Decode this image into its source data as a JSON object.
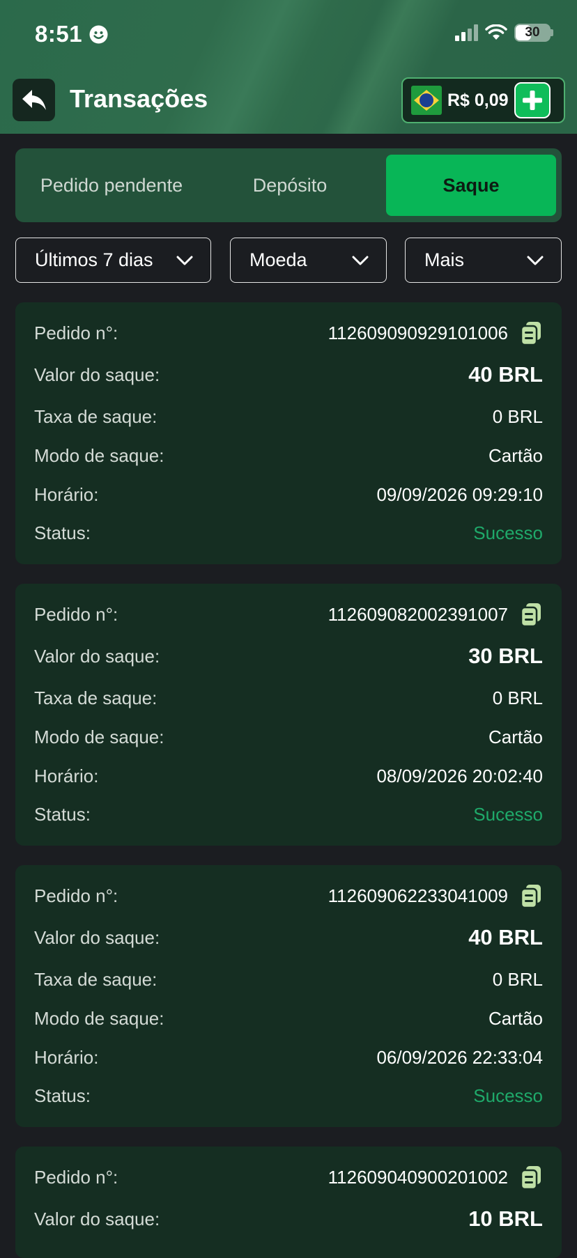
{
  "status_bar": {
    "time": "8:51",
    "battery": "30"
  },
  "header": {
    "title": "Transações",
    "balance": "R$ 0,09"
  },
  "tabs": [
    "Pedido pendente",
    "Depósito",
    "Saque"
  ],
  "filters": [
    "Últimos 7 dias",
    "Moeda",
    "Mais"
  ],
  "labels": {
    "order": "Pedido n°:",
    "amount": "Valor do saque:",
    "fee": "Taxa de saque:",
    "mode": "Modo de saque:",
    "time": "Horário:",
    "status": "Status:"
  },
  "transactions": [
    {
      "order": "112609090929101006",
      "amount": "40 BRL",
      "fee": "0 BRL",
      "mode": "Cartão",
      "time": "09/09/2026 09:29:10",
      "status": "Sucesso"
    },
    {
      "order": "112609082002391007",
      "amount": "30 BRL",
      "fee": "0 BRL",
      "mode": "Cartão",
      "time": "08/09/2026 20:02:40",
      "status": "Sucesso"
    },
    {
      "order": "112609062233041009",
      "amount": "40 BRL",
      "fee": "0 BRL",
      "mode": "Cartão",
      "time": "06/09/2026 22:33:04",
      "status": "Sucesso"
    },
    {
      "order": "112609040900201002",
      "amount": "10 BRL"
    }
  ],
  "colors": {
    "accent": "#08b657",
    "success": "#1fa96a",
    "card": "#152e22",
    "background": "#1b1d21"
  },
  "icons": {
    "back": "back-arrow-icon",
    "add": "plus-icon",
    "copy": "copy-icon",
    "dropdown": "chevron-down-icon",
    "flag": "brazil-flag-icon"
  }
}
